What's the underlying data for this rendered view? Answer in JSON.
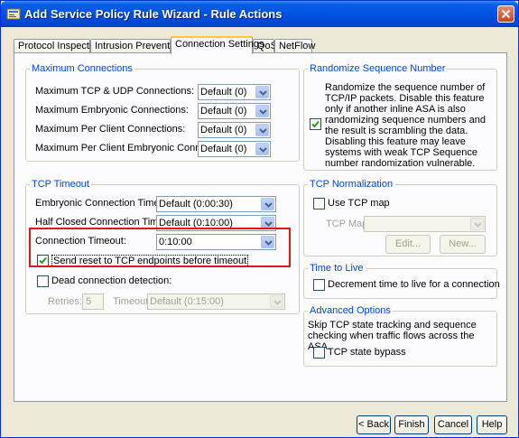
{
  "window": {
    "title": "Add Service Policy Rule Wizard - Rule Actions"
  },
  "tabs": [
    {
      "label": "Protocol Inspection"
    },
    {
      "label": "Intrusion Prevention"
    },
    {
      "label": "Connection Settings"
    },
    {
      "label": "QoS"
    },
    {
      "label": "NetFlow"
    }
  ],
  "max_connections": {
    "title": "Maximum Connections",
    "rows": [
      {
        "label": "Maximum TCP & UDP Connections:",
        "value": "Default (0)"
      },
      {
        "label": "Maximum Embryonic Connections:",
        "value": "Default (0)"
      },
      {
        "label": "Maximum Per Client Connections:",
        "value": "Default (0)"
      },
      {
        "label": "Maximum Per Client Embryonic Connections:",
        "value": "Default (0)"
      }
    ]
  },
  "randomize": {
    "title": "Randomize Sequence Number",
    "checked": true,
    "description": "Randomize the sequence number of TCP/IP packets. Disable this feature only if another inline ASA is also randomizing sequence numbers and the result is scrambling the data. Disabling this feature may leave systems with weak TCP Sequence number randomization vulnerable."
  },
  "tcp_timeout": {
    "title": "TCP Timeout",
    "embryonic_label": "Embryonic Connection Timeout:",
    "embryonic_value": "Default (0:00:30)",
    "half_closed_label": "Half Closed Connection Timeout:",
    "half_closed_value": "Default (0:10:00)",
    "connection_label": "Connection Timeout:",
    "connection_value": "0:10:00",
    "send_reset_label": "Send reset to TCP endpoints before timeout",
    "send_reset_checked": true,
    "dead_detection_label": "Dead connection detection:",
    "dead_detection_checked": false,
    "retries_label": "Retries:",
    "retries_value": "5",
    "timeout_label": "Timeout:",
    "timeout_value": "Default (0:15:00)"
  },
  "tcp_normalization": {
    "title": "TCP Normalization",
    "use_tcp_map_label": "Use TCP map",
    "use_tcp_map_checked": false,
    "tcp_map_label": "TCP Map:",
    "tcp_map_value": "",
    "edit_label": "Edit...",
    "new_label": "New..."
  },
  "time_to_live": {
    "title": "Time to Live",
    "decrement_label": "Decrement time to live for a connection",
    "decrement_checked": false
  },
  "advanced": {
    "title": "Advanced Options",
    "description": "Skip TCP state tracking and sequence checking when traffic flows across the ASA.",
    "bypass_label": "TCP state bypass",
    "bypass_checked": false
  },
  "footer": {
    "back_label": "< Back",
    "finish_label": "Finish",
    "cancel_label": "Cancel",
    "help_label": "Help"
  },
  "icons": {
    "combo_arrow": "chevron-down-icon",
    "checkmark": "check-icon",
    "close": "close-icon"
  },
  "colors": {
    "highlight": "#e0141a",
    "group_title": "#0046d5",
    "titlebar": "#0054e3"
  }
}
